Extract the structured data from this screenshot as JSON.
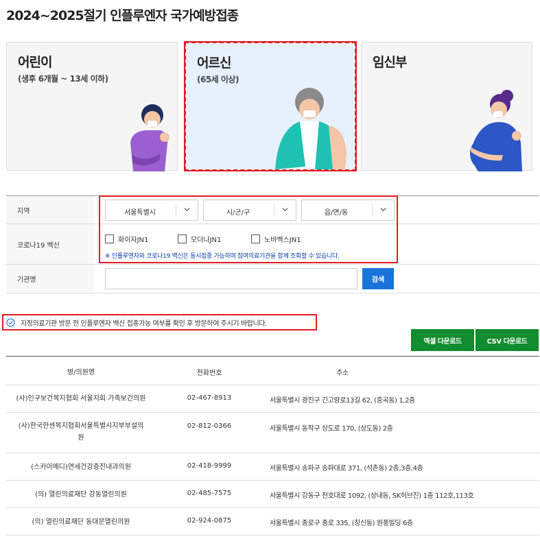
{
  "page": {
    "title": "2024~2025절기 인플루엔자 국가예방접종"
  },
  "cards": [
    {
      "title": "어린이",
      "sub": "(생후 6개월 ~ 13세 이하)"
    },
    {
      "title": "어르신",
      "sub": "(65세 이상)"
    },
    {
      "title": "임신부",
      "sub": ""
    }
  ],
  "form": {
    "region_label": "지역",
    "sido": "서울특별시",
    "sigungu": "시/군/구",
    "dong": "읍/면/동",
    "vaccine_label": "코로나19 백신",
    "vaccines": [
      "화이자JN1",
      "모더나JN1",
      "노바백스JN1"
    ],
    "vaccine_note": "※ 인플루엔자와 코로나19 백신은 동시접종 가능하며 참여의료기관을 함께 조회할 수 있습니다.",
    "org_label": "기관명",
    "org_value": "",
    "search_label": "검색"
  },
  "notice": "지정의료기관 방문 전 인플루엔자 백신 접종가능 여부를 확인 후 방문하여 주시기 바랍니다.",
  "downloads": {
    "excel": "엑셀 다운로드",
    "csv": "CSV 다운로드"
  },
  "table": {
    "headers": [
      "병/의원명",
      "전화번호",
      "주소"
    ],
    "rows": [
      {
        "name": "(사)인구보건복지협회 서울지회 가족보건의원",
        "phone": "02-467-8913",
        "addr": "서울특별시 광진구 긴고랑로13길 62, (중곡동) 1,2층"
      },
      {
        "name": "(사)한국한센복지협회서울특별시지부부설의원",
        "phone": "02-812-0366",
        "addr": "서울특별시 동작구 상도로 170, (상도동) 2층"
      },
      {
        "name": "(스카이메디)연세건강증진내과의원",
        "phone": "02-418-9999",
        "addr": "서울특별시 송파구 송파대로 371, (석촌동) 2층,3층,4층"
      },
      {
        "name": "(의) 열린의료재단 강동열린의원",
        "phone": "02-485-7575",
        "addr": "서울특별시 강동구 천호대로 1092, (상내동, SK허브진) 1층 112호,113호"
      },
      {
        "name": "(의) 열린의료재단 동대문열린의원",
        "phone": "02-924-0875",
        "addr": "서울특별시 종로구 종로 335, (창신동) 원풍빌딩 6층"
      }
    ]
  }
}
